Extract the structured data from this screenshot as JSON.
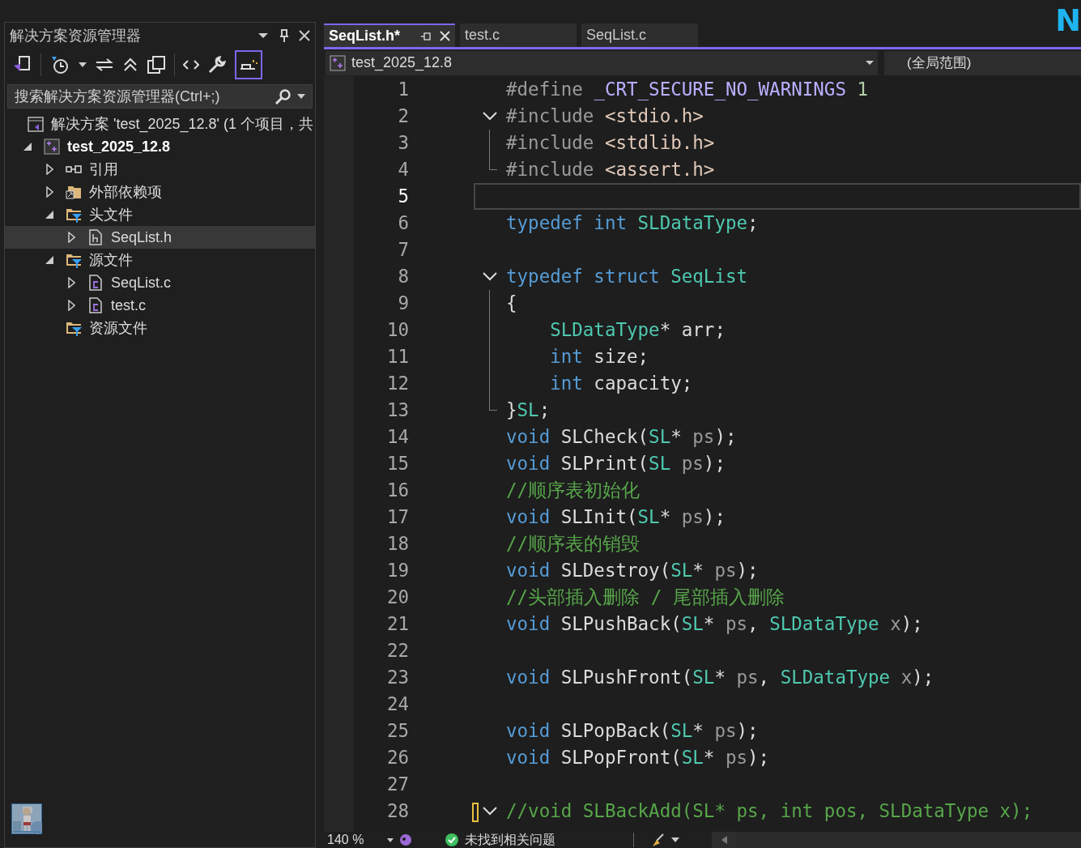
{
  "explorer": {
    "title": "解决方案资源管理器",
    "search": {
      "placeholder": "搜索解决方案资源管理器(Ctrl+;)"
    },
    "tree": [
      {
        "label": "解决方案 'test_2025_12.8' (1 个项目，共",
        "kind": "solution"
      },
      {
        "label": "test_2025_12.8",
        "kind": "project",
        "bold": true,
        "expanded": true,
        "selected": false,
        "children": [
          {
            "label": "引用",
            "kind": "reference",
            "expanded": false,
            "selected": false
          },
          {
            "label": "外部依赖项",
            "kind": "external",
            "expanded": false,
            "selected": false
          },
          {
            "label": "头文件",
            "kind": "filter",
            "expanded": true,
            "selected": false,
            "children": [
              {
                "label": "SeqList.h",
                "kind": "header",
                "expanded": false,
                "selected": true
              }
            ]
          },
          {
            "label": "源文件",
            "kind": "filter",
            "expanded": true,
            "selected": false,
            "children": [
              {
                "label": "SeqList.c",
                "kind": "source",
                "expanded": false,
                "selected": false
              },
              {
                "label": "test.c",
                "kind": "source",
                "expanded": false,
                "selected": false
              }
            ]
          },
          {
            "label": "资源文件",
            "kind": "filter",
            "selected": false
          }
        ]
      }
    ]
  },
  "corner_text": "N",
  "tabs": [
    {
      "label": "SeqList.h*",
      "selected": true
    },
    {
      "label": "test.c",
      "selected": false
    },
    {
      "label": "SeqList.c",
      "selected": false
    }
  ],
  "navbar": {
    "project": "test_2025_12.8",
    "scope": "(全局范围)"
  },
  "code": [
    {
      "number": "1",
      "tokens": [
        {
          "kind": "pre",
          "text": "#define "
        },
        {
          "kind": "macro",
          "text": "_CRT_SECURE_NO_WARNINGS"
        },
        {
          "kind": "num",
          "text": " 1"
        }
      ]
    },
    {
      "number": "2",
      "collapsible": true,
      "tokens": [
        {
          "kind": "pre",
          "text": "#include "
        },
        {
          "kind": "header",
          "text": "<stdio.h>"
        }
      ]
    },
    {
      "number": "3",
      "guide": true,
      "tokens": [
        {
          "kind": "pre",
          "text": "#include "
        },
        {
          "kind": "header",
          "text": "<stdlib.h>"
        }
      ]
    },
    {
      "number": "4",
      "guide": true,
      "tokens": [
        {
          "kind": "pre",
          "text": "#include "
        },
        {
          "kind": "header",
          "text": "<assert.h>"
        }
      ]
    },
    {
      "number": "5",
      "current": true
    },
    {
      "number": "6",
      "tokens": [
        {
          "kind": "kw",
          "text": "typedef int "
        },
        {
          "kind": "type",
          "text": "SLDataType"
        },
        {
          "kind": "plain",
          "text": ";"
        }
      ]
    },
    {
      "number": "7"
    },
    {
      "number": "8",
      "collapsible": true,
      "tokens": [
        {
          "kind": "kw",
          "text": "typedef struct "
        },
        {
          "kind": "type",
          "text": "SeqList"
        }
      ]
    },
    {
      "number": "9",
      "guide": true,
      "tokens": [
        {
          "kind": "plain",
          "text": "{"
        }
      ]
    },
    {
      "number": "10",
      "guide": true,
      "tokens": [
        {
          "kind": "type",
          "text": "    SLDataType"
        },
        {
          "kind": "plain",
          "text": "* arr;"
        }
      ]
    },
    {
      "number": "11",
      "guide": true,
      "tokens": [
        {
          "kind": "kw",
          "text": "    int"
        },
        {
          "kind": "plain",
          "text": " size;"
        }
      ]
    },
    {
      "number": "12",
      "guide": true,
      "tokens": [
        {
          "kind": "kw",
          "text": "    int"
        },
        {
          "kind": "plain",
          "text": " capacity;"
        }
      ]
    },
    {
      "number": "13",
      "guide": true,
      "tokens": [
        {
          "kind": "plain",
          "text": "}"
        },
        {
          "kind": "type",
          "text": "SL"
        },
        {
          "kind": "plain",
          "text": ";"
        }
      ]
    },
    {
      "number": "14",
      "tokens": [
        {
          "kind": "kw",
          "text": "void "
        },
        {
          "kind": "plain",
          "text": "SLCheck("
        },
        {
          "kind": "type",
          "text": "SL"
        },
        {
          "kind": "plain",
          "text": "* "
        },
        {
          "kind": "param",
          "text": "ps"
        },
        {
          "kind": "plain",
          "text": ");"
        }
      ]
    },
    {
      "number": "15",
      "tokens": [
        {
          "kind": "kw",
          "text": "void "
        },
        {
          "kind": "plain",
          "text": "SLPrint("
        },
        {
          "kind": "type",
          "text": "SL "
        },
        {
          "kind": "param",
          "text": "ps"
        },
        {
          "kind": "plain",
          "text": ");"
        }
      ]
    },
    {
      "number": "16",
      "tokens": [
        {
          "kind": "comment",
          "text": "//顺序表初始化"
        }
      ]
    },
    {
      "number": "17",
      "tokens": [
        {
          "kind": "kw",
          "text": "void "
        },
        {
          "kind": "plain",
          "text": "SLInit("
        },
        {
          "kind": "type",
          "text": "SL"
        },
        {
          "kind": "plain",
          "text": "* "
        },
        {
          "kind": "param",
          "text": "ps"
        },
        {
          "kind": "plain",
          "text": ");"
        }
      ]
    },
    {
      "number": "18",
      "tokens": [
        {
          "kind": "comment",
          "text": "//顺序表的销毁"
        }
      ]
    },
    {
      "number": "19",
      "tokens": [
        {
          "kind": "kw",
          "text": "void "
        },
        {
          "kind": "plain",
          "text": "SLDestroy("
        },
        {
          "kind": "type",
          "text": "SL"
        },
        {
          "kind": "plain",
          "text": "* "
        },
        {
          "kind": "param",
          "text": "ps"
        },
        {
          "kind": "plain",
          "text": ");"
        }
      ]
    },
    {
      "number": "20",
      "tokens": [
        {
          "kind": "comment",
          "text": "//头部插入删除 / 尾部插入删除"
        }
      ]
    },
    {
      "number": "21",
      "tokens": [
        {
          "kind": "kw",
          "text": "void "
        },
        {
          "kind": "plain",
          "text": "SLPushBack("
        },
        {
          "kind": "type",
          "text": "SL"
        },
        {
          "kind": "plain",
          "text": "* "
        },
        {
          "kind": "param",
          "text": "ps"
        },
        {
          "kind": "plain",
          "text": ", "
        },
        {
          "kind": "type",
          "text": "SLDataType "
        },
        {
          "kind": "param",
          "text": "x"
        },
        {
          "kind": "plain",
          "text": ");"
        }
      ]
    },
    {
      "number": "22"
    },
    {
      "number": "23",
      "tokens": [
        {
          "kind": "kw",
          "text": "void "
        },
        {
          "kind": "plain",
          "text": "SLPushFront("
        },
        {
          "kind": "type",
          "text": "SL"
        },
        {
          "kind": "plain",
          "text": "* "
        },
        {
          "kind": "param",
          "text": "ps"
        },
        {
          "kind": "plain",
          "text": ", "
        },
        {
          "kind": "type",
          "text": "SLDataType "
        },
        {
          "kind": "param",
          "text": "x"
        },
        {
          "kind": "plain",
          "text": ");"
        }
      ]
    },
    {
      "number": "24"
    },
    {
      "number": "25",
      "tokens": [
        {
          "kind": "kw",
          "text": "void "
        },
        {
          "kind": "plain",
          "text": "SLPopBack("
        },
        {
          "kind": "type",
          "text": "SL"
        },
        {
          "kind": "plain",
          "text": "* "
        },
        {
          "kind": "param",
          "text": "ps"
        },
        {
          "kind": "plain",
          "text": ");"
        }
      ]
    },
    {
      "number": "26",
      "tokens": [
        {
          "kind": "kw",
          "text": "void "
        },
        {
          "kind": "plain",
          "text": "SLPopFront("
        },
        {
          "kind": "type",
          "text": "SL"
        },
        {
          "kind": "plain",
          "text": "* "
        },
        {
          "kind": "param",
          "text": "ps"
        },
        {
          "kind": "plain",
          "text": ");"
        }
      ]
    },
    {
      "number": "27"
    },
    {
      "number": "28",
      "collapsible": true,
      "changed": true,
      "tokens": [
        {
          "kind": "comment",
          "text": "//void SLBackAdd(SL* ps, int pos, SLDataType x);"
        }
      ]
    }
  ],
  "status": {
    "zoom": "140 %",
    "issues": "未找到相关问题"
  }
}
